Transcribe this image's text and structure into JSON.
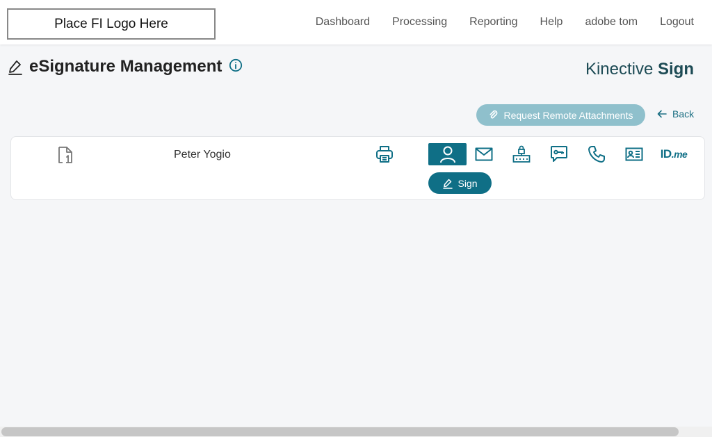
{
  "header": {
    "logo_text": "Place FI Logo Here",
    "nav": [
      "Dashboard",
      "Processing",
      "Reporting",
      "Help",
      "adobe tom",
      "Logout"
    ]
  },
  "page": {
    "title": "eSignature Management",
    "brand_light": "Kinective ",
    "brand_bold": "Sign"
  },
  "actions": {
    "request_remote_label": "Request Remote Attachments",
    "back_label": "Back"
  },
  "signer": {
    "name": "Peter Yogio",
    "sign_label": "Sign",
    "idme_label": "ID",
    "idme_suffix": ".me",
    "methods": [
      "person-icon",
      "email-icon",
      "router-icon",
      "chat-key-icon",
      "phone-icon",
      "id-card-icon",
      "idme-icon"
    ],
    "active_method": "person-icon"
  },
  "colors": {
    "accent": "#0f6f86",
    "accent_light": "#8fc0cc",
    "brand": "#1d4b55"
  }
}
